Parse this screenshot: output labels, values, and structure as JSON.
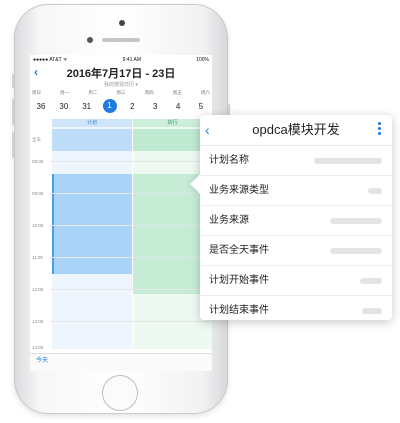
{
  "status_bar": {
    "carrier": "●●●●● AT&T ᯤ",
    "time": "9:41 AM",
    "battery": "100%"
  },
  "calendar": {
    "title": "2016年7月17日 - 23日",
    "subtitle": "我的按週日历 ▾",
    "weekdays": [
      "周日",
      "周一",
      "周二",
      "周三",
      "周四",
      "周五",
      "周六"
    ],
    "dates": [
      "36",
      "30",
      "31",
      "1",
      "2",
      "3",
      "4",
      "5"
    ],
    "selected_date": "1",
    "columns": {
      "plan": "计划",
      "execute": "执行"
    },
    "all_day_label": "全天",
    "times": [
      "08:00",
      "09:00",
      "10:00",
      "11:00",
      "12:00",
      "13:00",
      "14:00"
    ],
    "today_button": "今天"
  },
  "card": {
    "title": "opdca模块开发",
    "fields": [
      {
        "label": "计划名称"
      },
      {
        "label": "业务来源类型"
      },
      {
        "label": "业务来源"
      },
      {
        "label": "是否全天事件"
      },
      {
        "label": "计划开始事件"
      },
      {
        "label": "计划结束事件"
      }
    ]
  },
  "colors": {
    "accent": "#1e7be0",
    "plan": "#a9d4f7",
    "execute": "#c6ecd6"
  }
}
